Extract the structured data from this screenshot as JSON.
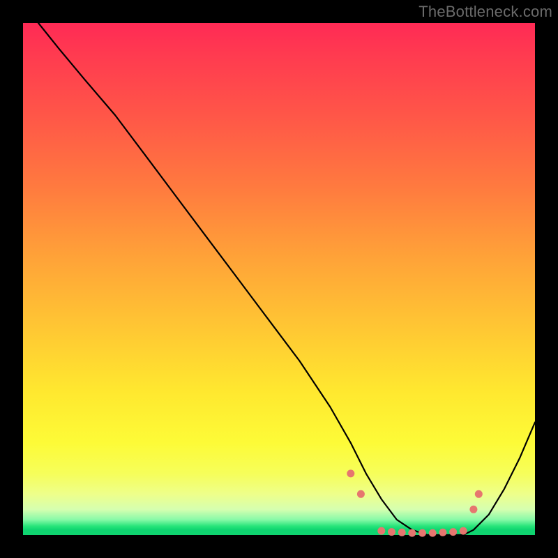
{
  "watermark": "TheBottleneck.com",
  "chart_data": {
    "type": "line",
    "title": "",
    "xlabel": "",
    "ylabel": "",
    "xlim": [
      0,
      100
    ],
    "ylim": [
      0,
      100
    ],
    "grid": false,
    "legend": false,
    "series": [
      {
        "name": "bottleneck-curve",
        "x": [
          3,
          7,
          12,
          18,
          24,
          30,
          36,
          42,
          48,
          54,
          60,
          64,
          67,
          70,
          73,
          76,
          79,
          82,
          84,
          86,
          88,
          91,
          94,
          97,
          100
        ],
        "y": [
          100,
          95,
          89,
          82,
          74,
          66,
          58,
          50,
          42,
          34,
          25,
          18,
          12,
          7,
          3,
          1,
          0,
          0,
          0,
          0,
          1,
          4,
          9,
          15,
          22
        ]
      }
    ],
    "markers": {
      "name": "salmon-dots",
      "x": [
        64,
        66,
        70,
        72,
        74,
        76,
        78,
        80,
        82,
        84,
        86,
        88,
        89
      ],
      "y": [
        12,
        8,
        0.8,
        0.6,
        0.5,
        0.4,
        0.4,
        0.4,
        0.5,
        0.6,
        0.8,
        5,
        8
      ]
    },
    "background": {
      "type": "vertical-gradient",
      "stops": [
        {
          "pos": 0,
          "color": "#ff2a55"
        },
        {
          "pos": 40,
          "color": "#ff8a3c"
        },
        {
          "pos": 72,
          "color": "#ffe82f"
        },
        {
          "pos": 92,
          "color": "#eeff8a"
        },
        {
          "pos": 99,
          "color": "#0fd470"
        }
      ]
    }
  }
}
